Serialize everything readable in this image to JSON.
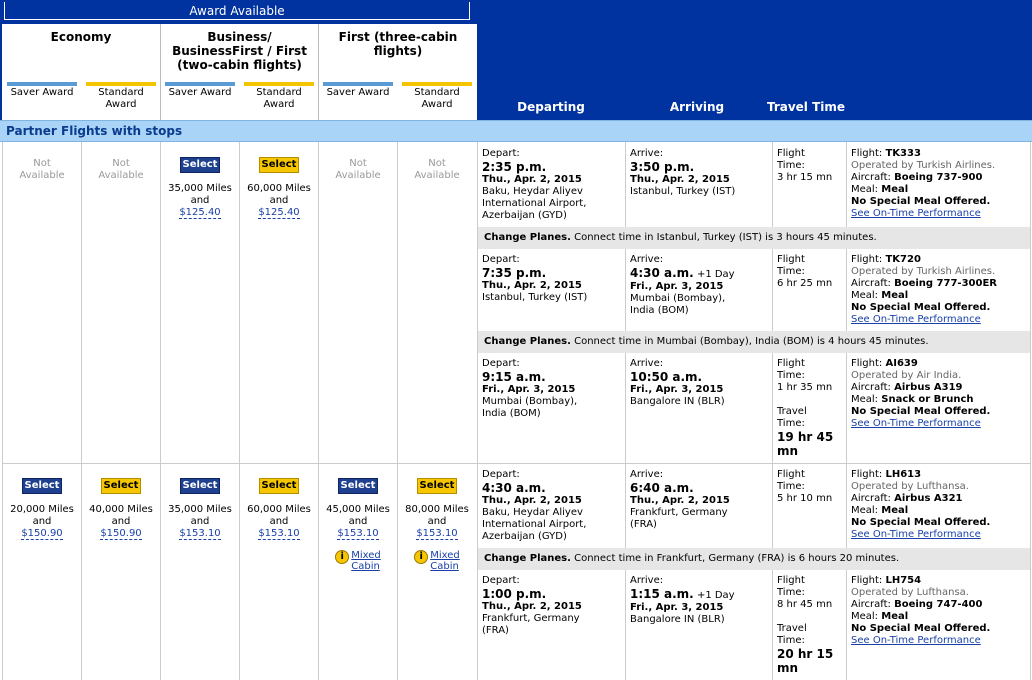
{
  "header": {
    "award_available": "Award Available",
    "cabins": [
      {
        "name": "Economy",
        "saver": "Saver Award",
        "standard_l1": "Standard",
        "standard_l2": "Award"
      },
      {
        "name_l1": "Business/",
        "name_l2": "BusinessFirst / First",
        "name_l3": "(two-cabin flights)",
        "saver": "Saver Award",
        "standard_l1": "Standard",
        "standard_l2": "Award"
      },
      {
        "name_l1": "First (three-cabin",
        "name_l2": "flights)",
        "saver": "Saver Award",
        "standard_l1": "Standard",
        "standard_l2": "Award"
      }
    ],
    "departing": "Departing",
    "arriving": "Arriving",
    "travel_time": "Travel Time"
  },
  "section_title": "Partner Flights with stops",
  "labels": {
    "not": "Not",
    "available": "Available",
    "select": "Select",
    "and": "and",
    "depart": "Depart:",
    "arrive": "Arrive:",
    "flight": "Flight",
    "time": "Time:",
    "travel": "Travel",
    "flight_label": "Flight:",
    "aircraft_label": "Aircraft:",
    "meal_label": "Meal:",
    "on_time": "See On-Time Performance",
    "change_planes": "Change Planes.",
    "plus_one_day": "+1 Day",
    "mixed": "Mixed",
    "cabin": "Cabin",
    "info_icon": "i"
  },
  "option1": {
    "prices": [
      {
        "miles": "35,000 Miles",
        "cash": "$125.40"
      },
      {
        "miles": "60,000 Miles",
        "cash": "$125.40"
      }
    ],
    "segments": [
      {
        "dep_time": "2:35 p.m.",
        "dep_date": "Thu., Apr. 2, 2015",
        "dep_city_l1": "Baku, Heydar Aliyev",
        "dep_city_l2": "International Airport,",
        "dep_city_l3": "Azerbaijan (GYD)",
        "arr_time": "3:50 p.m.",
        "arr_date": "Thu., Apr. 2, 2015",
        "arr_city_l1": "Istanbul, Turkey (IST)",
        "arr_city_l2": "",
        "duration": "3 hr 15 mn",
        "flight": "TK333",
        "operated": "Operated by Turkish Airlines.",
        "aircraft": "Boeing 737-900",
        "meal": "Meal",
        "special": "No Special Meal Offered."
      },
      {
        "dep_time": "7:35 p.m.",
        "dep_date": "Thu., Apr. 2, 2015",
        "dep_city_l1": "Istanbul, Turkey (IST)",
        "dep_city_l2": "",
        "dep_city_l3": "",
        "arr_time": "4:30 a.m.",
        "arr_date": "Fri., Apr. 3, 2015",
        "arr_city_l1": "Mumbai (Bombay),",
        "arr_city_l2": "India (BOM)",
        "duration": "6 hr 25 mn",
        "flight": "TK720",
        "operated": "Operated by Turkish Airlines.",
        "aircraft": "Boeing 777-300ER",
        "meal": "Meal",
        "special": "No Special Meal Offered."
      },
      {
        "dep_time": "9:15 a.m.",
        "dep_date": "Fri., Apr. 3, 2015",
        "dep_city_l1": "Mumbai (Bombay),",
        "dep_city_l2": "India (BOM)",
        "dep_city_l3": "",
        "arr_time": "10:50 a.m.",
        "arr_date": "Fri., Apr. 3, 2015",
        "arr_city_l1": "Bangalore IN (BLR)",
        "arr_city_l2": "",
        "duration": "1 hr 35 mn",
        "flight": "AI639",
        "operated": "Operated by Air India.",
        "aircraft": "Airbus A319",
        "meal": "Snack or Brunch",
        "special": "No Special Meal Offered."
      }
    ],
    "connections": [
      "Connect time in Istanbul, Turkey (IST) is 3 hours 45 minutes.",
      "Connect time in Mumbai (Bombay), India (BOM) is 4 hours 45 minutes."
    ],
    "total_l1": "19 hr 45",
    "total_l2": "mn"
  },
  "option2": {
    "prices": [
      {
        "miles": "20,000 Miles",
        "cash": "$150.90"
      },
      {
        "miles": "40,000 Miles",
        "cash": "$150.90"
      },
      {
        "miles": "35,000 Miles",
        "cash": "$153.10"
      },
      {
        "miles": "60,000 Miles",
        "cash": "$153.10"
      },
      {
        "miles": "45,000 Miles",
        "cash": "$153.10"
      },
      {
        "miles": "80,000 Miles",
        "cash": "$153.10"
      }
    ],
    "segments": [
      {
        "dep_time": "4:30 a.m.",
        "dep_date": "Thu., Apr. 2, 2015",
        "dep_city_l1": "Baku, Heydar Aliyev",
        "dep_city_l2": "International Airport,",
        "dep_city_l3": "Azerbaijan (GYD)",
        "arr_time": "6:40 a.m.",
        "arr_date": "Thu., Apr. 2, 2015",
        "arr_city_l1": "Frankfurt, Germany",
        "arr_city_l2": "(FRA)",
        "duration": "5 hr 10 mn",
        "flight": "LH613",
        "operated": "Operated by Lufthansa.",
        "aircraft": "Airbus A321",
        "meal": "Meal",
        "special": "No Special Meal Offered."
      },
      {
        "dep_time": "1:00 p.m.",
        "dep_date": "Thu., Apr. 2, 2015",
        "dep_city_l1": "Frankfurt, Germany",
        "dep_city_l2": "(FRA)",
        "dep_city_l3": "",
        "arr_time": "1:15 a.m.",
        "arr_date": "Fri., Apr. 3, 2015",
        "arr_city_l1": "Bangalore IN (BLR)",
        "arr_city_l2": "",
        "duration": "8 hr 45 mn",
        "flight": "LH754",
        "operated": "Operated by Lufthansa.",
        "aircraft": "Boeing 747-400",
        "meal": "Meal",
        "special": "No Special Meal Offered."
      }
    ],
    "connections": [
      "Connect time in Frankfurt, Germany (FRA) is 6 hours 20 minutes."
    ],
    "total_l1": "20 hr 15",
    "total_l2": "mn"
  },
  "colors": {
    "header_bg": "#0033a0",
    "section_bar": "#aad4f7",
    "saver": "#5b9bd5",
    "standard": "#f5c400",
    "select_blue": "#1f3f8f",
    "select_yellow": "#f6c700"
  }
}
